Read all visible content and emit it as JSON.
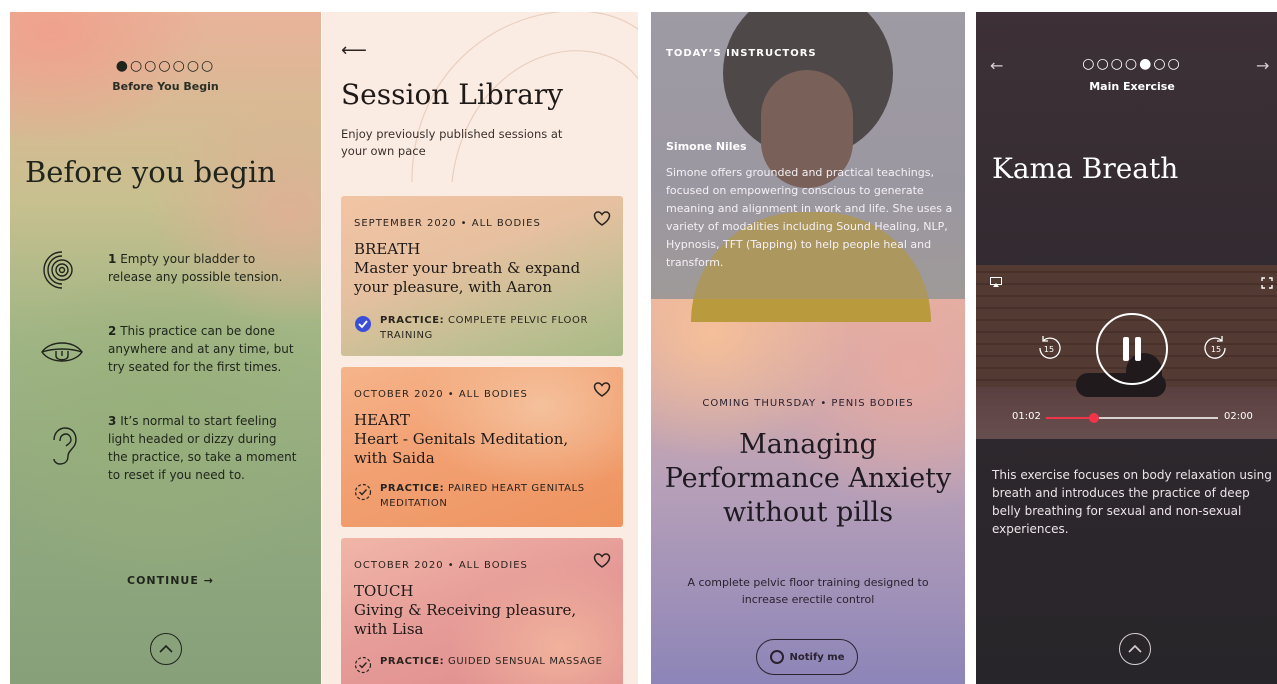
{
  "colors": {
    "sage": "#93aa7f",
    "peach": "#f2a072",
    "rose": "#e69c98",
    "dark": "#2c272c",
    "progress": "#f0354a"
  },
  "panel1": {
    "dots": "●○○○○○○",
    "step_label": "Before You Begin",
    "title": "Before you begin",
    "tips": [
      {
        "num": "1",
        "text": "Empty your bladder to release any possible tension.",
        "icon": "spiral-icon"
      },
      {
        "num": "2",
        "text": "This practice can be done anywhere and at any time, but try seated for the first times.",
        "icon": "mouth-icon"
      },
      {
        "num": "3",
        "text": "It’s normal to start feeling light headed or dizzy during the practice, so take a moment to reset if you need to.",
        "icon": "ear-icon"
      }
    ],
    "continue_label": "CONTINUE →",
    "up_icon": "chevron-up-icon"
  },
  "panel2": {
    "back_arrow": "⟵",
    "title": "Session Library",
    "subtitle": "Enjoy previously published sessions at your own pace",
    "cards": [
      {
        "meta": "SEPTEMBER 2020 • ALL BODIES",
        "category": "BREATH",
        "title": "Master your breath & expand your pleasure, with Aaron",
        "practice_label": "PRACTICE:",
        "practice": "COMPLETE PELVIC FLOOR TRAINING",
        "status": "completed"
      },
      {
        "meta": "OCTOBER 2020 • ALL BODIES",
        "category": "HEART",
        "title": "Heart - Genitals Meditation, with Saida",
        "practice_label": "PRACTICE:",
        "practice": "PAIRED HEART GENITALS MEDITATION",
        "status": "pending"
      },
      {
        "meta": "OCTOBER 2020 • ALL BODIES",
        "category": "TOUCH",
        "title": "Giving & Receiving pleasure, with Lisa",
        "practice_label": "PRACTICE:",
        "practice": "GUIDED SENSUAL MASSAGE",
        "status": "pending"
      }
    ]
  },
  "panel3": {
    "section_label": "TODAY’S INSTRUCTORS",
    "instructor_name": "Simone Niles",
    "bio": "Simone offers grounded and practical teachings, focused on empowering conscious to generate meaning and alignment in work and life. She uses a variety of modalities including Sound Healing, NLP, Hypnosis, TFT (Tapping) to help people heal and transform.",
    "meta": "COMING THURSDAY • PENIS BODIES",
    "title": "Managing Performance Anxiety without pills",
    "description": "A complete pelvic floor training designed to increase erectile control",
    "notify_label": "Notify me"
  },
  "panel4": {
    "back_arrow": "←",
    "next_arrow": "→",
    "dots": "○○○○●○○",
    "step_label": "Main Exercise",
    "title": "Kama Breath",
    "video": {
      "elapsed": "01:02",
      "duration": "02:00",
      "progress": 0.28,
      "rewind_label": "15",
      "forward_label": "15"
    },
    "description": "This exercise focuses on body relaxation using breath and introduces the practice of deep belly breathing for sexual and non-sexual experiences."
  }
}
